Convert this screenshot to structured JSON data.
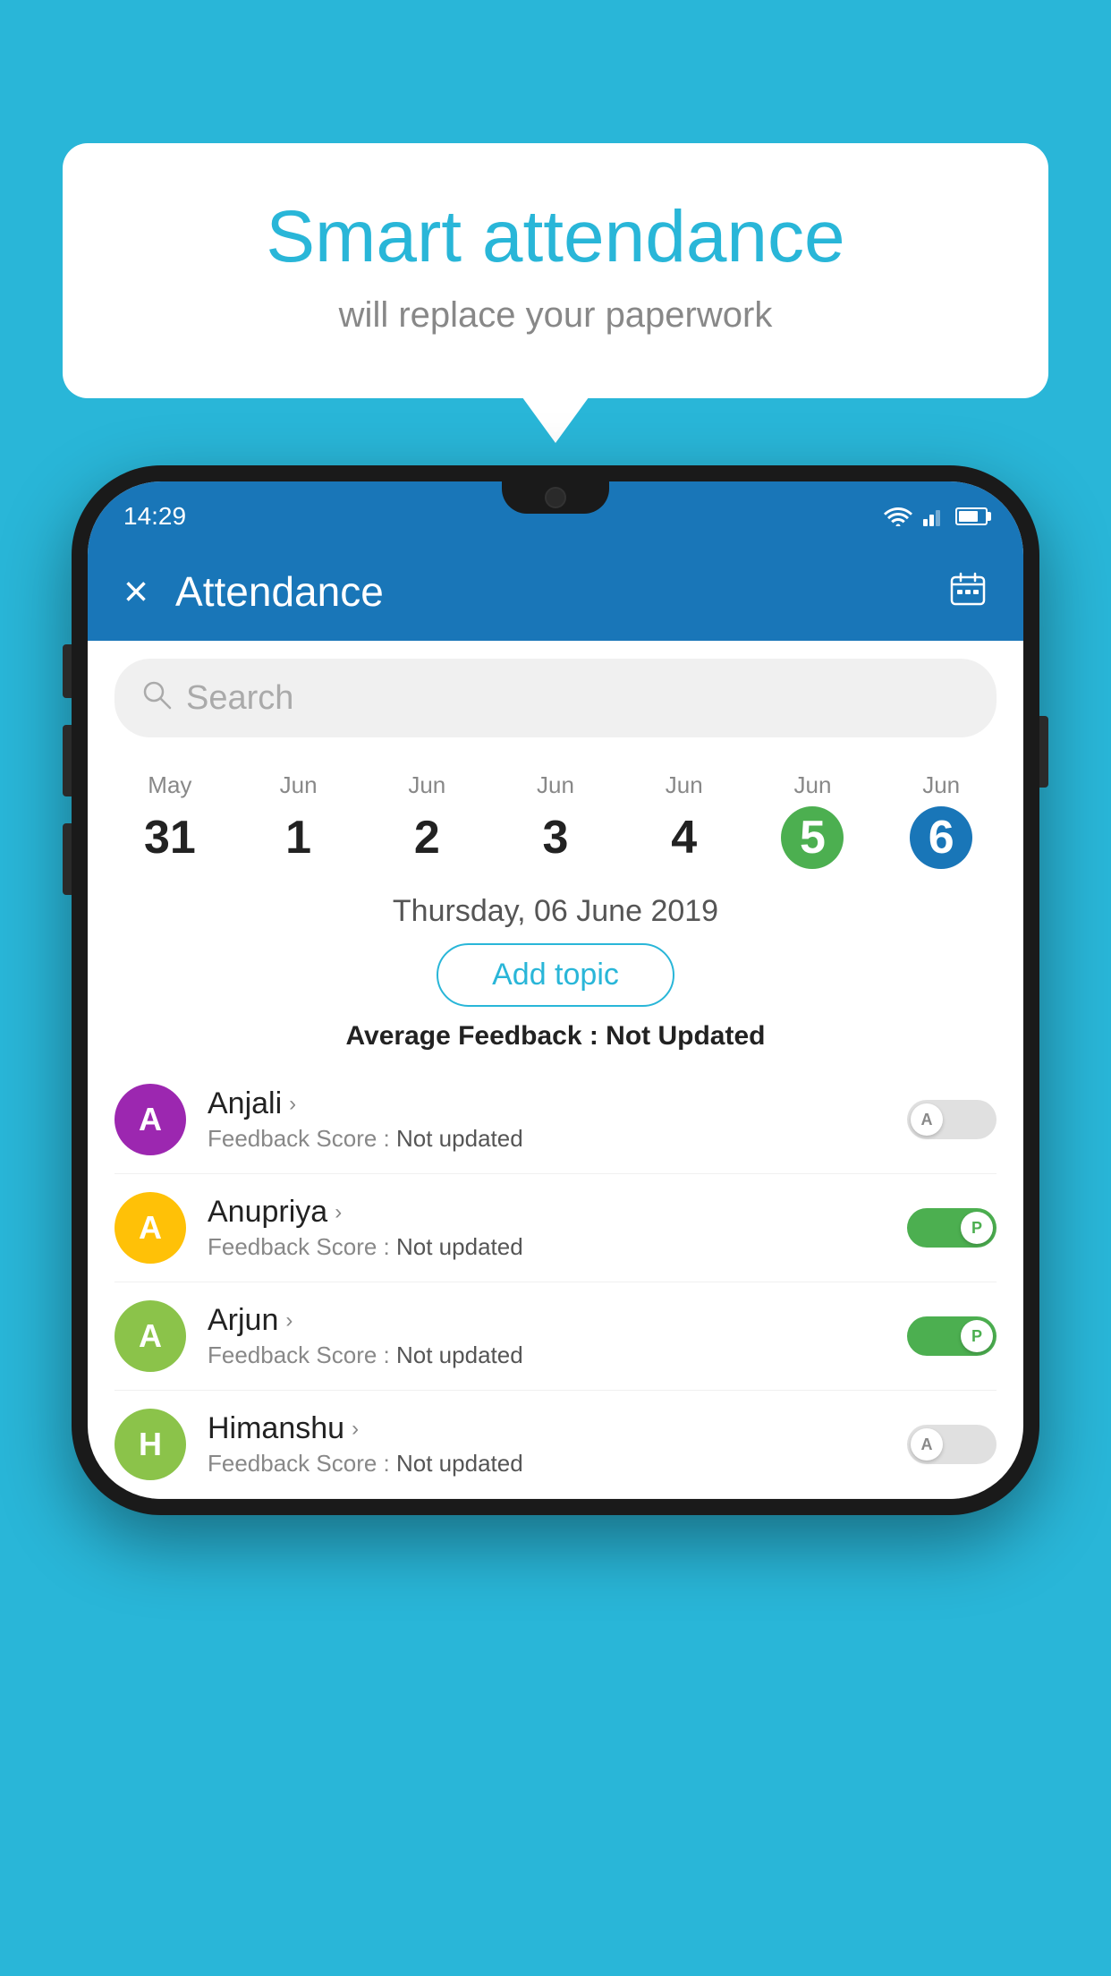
{
  "background_color": "#29b6d8",
  "bubble": {
    "title": "Smart attendance",
    "subtitle": "will replace your paperwork"
  },
  "status_bar": {
    "time": "14:29",
    "icons": [
      "wifi",
      "signal",
      "battery"
    ]
  },
  "app_bar": {
    "title": "Attendance",
    "close_label": "×"
  },
  "search": {
    "placeholder": "Search"
  },
  "calendar": {
    "days": [
      {
        "month": "May",
        "date": "31",
        "state": "normal"
      },
      {
        "month": "Jun",
        "date": "1",
        "state": "normal"
      },
      {
        "month": "Jun",
        "date": "2",
        "state": "normal"
      },
      {
        "month": "Jun",
        "date": "3",
        "state": "normal"
      },
      {
        "month": "Jun",
        "date": "4",
        "state": "normal"
      },
      {
        "month": "Jun",
        "date": "5",
        "state": "today"
      },
      {
        "month": "Jun",
        "date": "6",
        "state": "selected"
      }
    ],
    "selected_date": "Thursday, 06 June 2019"
  },
  "add_topic_label": "Add topic",
  "avg_feedback": {
    "label": "Average Feedback : ",
    "value": "Not Updated"
  },
  "students": [
    {
      "name": "Anjali",
      "avatar_letter": "A",
      "avatar_color": "#9c27b0",
      "feedback_label": "Feedback Score : ",
      "feedback_value": "Not updated",
      "toggle_state": "off",
      "toggle_letter": "A"
    },
    {
      "name": "Anupriya",
      "avatar_letter": "A",
      "avatar_color": "#ffc107",
      "feedback_label": "Feedback Score : ",
      "feedback_value": "Not updated",
      "toggle_state": "on",
      "toggle_letter": "P"
    },
    {
      "name": "Arjun",
      "avatar_letter": "A",
      "avatar_color": "#8bc34a",
      "feedback_label": "Feedback Score : ",
      "feedback_value": "Not updated",
      "toggle_state": "on",
      "toggle_letter": "P"
    },
    {
      "name": "Himanshu",
      "avatar_letter": "H",
      "avatar_color": "#8bc34a",
      "feedback_label": "Feedback Score : ",
      "feedback_value": "Not updated",
      "toggle_state": "off",
      "toggle_letter": "A"
    }
  ]
}
